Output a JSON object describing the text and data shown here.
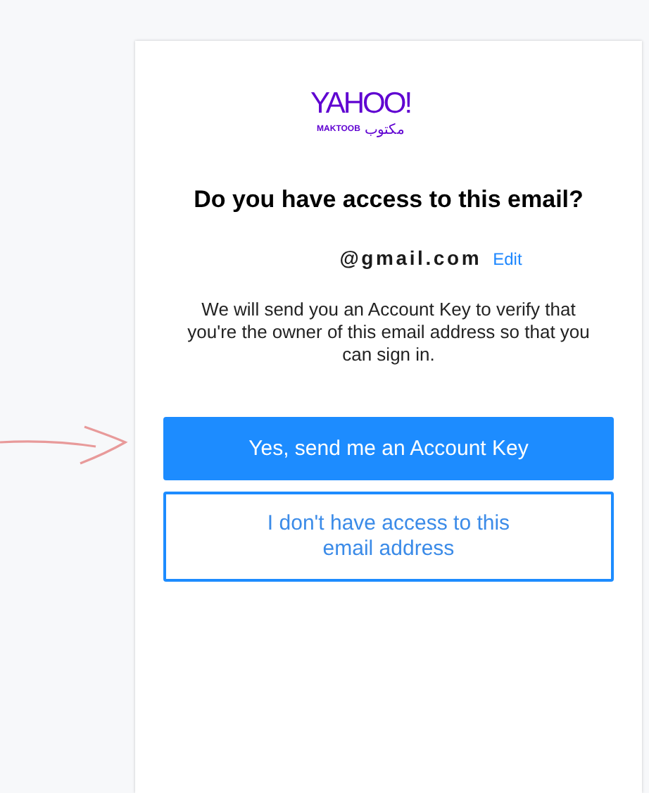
{
  "logo": {
    "wordmark": "YAHOO!",
    "subtitle_latin": "MAKTOOB",
    "subtitle_arabic": "مكتوب"
  },
  "heading": "Do you have access to this email?",
  "email": {
    "value": "@gmail.com",
    "edit_link": "Edit"
  },
  "message": "We will send you an Account Key to verify that you're the owner of this email address so that you can sign in.",
  "buttons": [
    {
      "label": "Yes, send me an Account Key",
      "kind": "primary"
    },
    {
      "label": "I don't have access to this email address",
      "kind": "secondary"
    }
  ]
}
